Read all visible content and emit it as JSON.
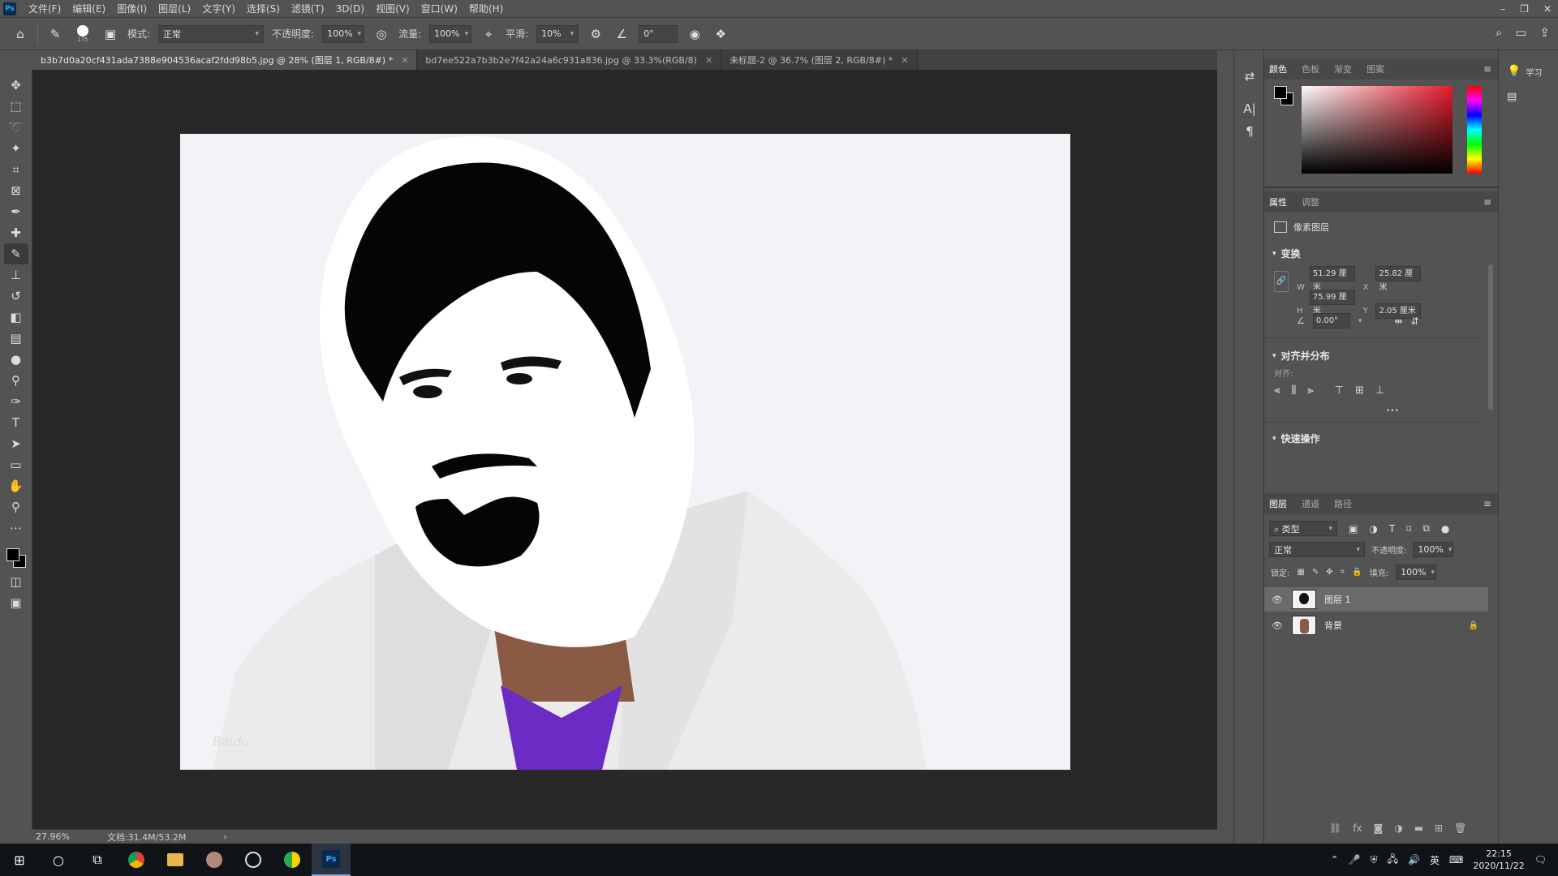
{
  "app": {
    "logo": "Ps"
  },
  "menubar": {
    "items": [
      "文件(F)",
      "编辑(E)",
      "图像(I)",
      "图层(L)",
      "文字(Y)",
      "选择(S)",
      "滤镜(T)",
      "3D(D)",
      "视图(V)",
      "窗口(W)",
      "帮助(H)"
    ],
    "window_controls": {
      "minimize": "–",
      "restore": "❐",
      "close": "✕"
    }
  },
  "options_bar": {
    "brush_size": "175",
    "mode_label": "模式:",
    "mode_value": "正常",
    "opacity_label": "不透明度:",
    "opacity_value": "100%",
    "flow_label": "流量:",
    "flow_value": "100%",
    "smoothing_label": "平滑:",
    "smoothing_value": "10%",
    "angle_value": "0°"
  },
  "tabs": [
    {
      "title": "b3b7d0a20cf431ada7388e904536acaf2fdd98b5.jpg @ 28% (图层 1, RGB/8#) *",
      "active": true
    },
    {
      "title": "bd7ee522a7b3b2e7f42a24a6c931a836.jpg @ 33.3%(RGB/8)",
      "active": false
    },
    {
      "title": "未标题-2 @ 36.7% (图层 2, RGB/8#) *",
      "active": false
    }
  ],
  "canvas": {
    "watermark": "Baidu"
  },
  "status_bar": {
    "zoom": "27.96%",
    "doc_info": "文档:31.4M/53.2M",
    "arrow": "›"
  },
  "color_panel": {
    "tabs": [
      "颜色",
      "色板",
      "渐变",
      "图案"
    ],
    "active_tab": "颜色"
  },
  "properties_panel": {
    "tabs": [
      "属性",
      "调整"
    ],
    "active_tab": "属性",
    "layer_type": "像素图层",
    "transform_title": "变换",
    "w_label": "W",
    "w_value": "51.29 厘米",
    "h_label": "H",
    "h_value": "75.99 厘米",
    "x_label": "X",
    "x_value": "25.82 厘米",
    "y_label": "Y",
    "y_value": "2.05 厘米",
    "angle_value": "0.00°",
    "align_title": "对齐并分布",
    "align_label": "对齐:",
    "more": "•••",
    "quick_title": "快速操作"
  },
  "layers_panel": {
    "tabs": [
      "图层",
      "通道",
      "路径"
    ],
    "active_tab": "图层",
    "filter_label": "类型",
    "blend_mode": "正常",
    "opacity_label": "不透明度:",
    "opacity_value": "100%",
    "lock_label": "锁定:",
    "fill_label": "填充:",
    "fill_value": "100%",
    "layers": [
      {
        "name": "图层 1",
        "selected": true,
        "locked": false
      },
      {
        "name": "背景",
        "selected": false,
        "locked": true
      }
    ]
  },
  "right_strip": {
    "learn_label": "学习"
  },
  "taskbar": {
    "apps": [
      "start-icon",
      "search-icon",
      "task-view-icon",
      "chrome-icon",
      "explorer-icon",
      "app-icon",
      "obs-icon",
      "app2-icon",
      "photoshop-icon"
    ],
    "ime": "英",
    "time": "22:15",
    "date": "2020/11/22"
  }
}
